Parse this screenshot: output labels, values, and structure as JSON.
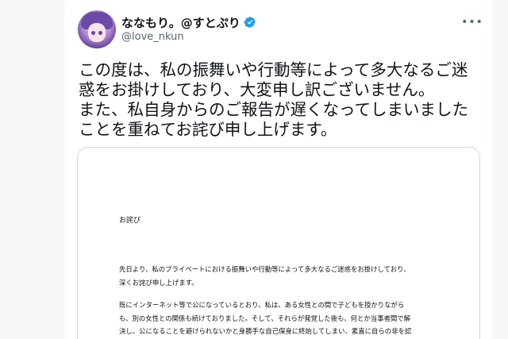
{
  "tweet": {
    "display_name": "ななもり。@すとぷり",
    "handle": "@love_nkun",
    "more_label": "•••",
    "text": "この度は、私の振舞いや行動等によって多大なるご迷惑をお掛けしており、大変申し訳ございません。\nまた、私自身からのご報告が遅くなってしまいましたことを重ねてお詫び申し上げます。",
    "verified_color": "#1d9bf0"
  },
  "attachment": {
    "title": "お詫び",
    "paragraph1": "先日より、私のプライベートにおける振舞いや行動等によって多大なるご迷惑をお掛けしており、\n深くお詫び申し上げます。",
    "paragraph2": "既にインターネット等で公になっているとおり、私は、ある女性との間で子どもを授かりながら\nも、別の女性との関係も続けておりました。そして、それらが発覚した後も、何とか当事者間で解\n決し、公になることを避けられないかと身勝手な自己保身に終始してしまい、素直に自らの非を認\nめてお相手の方々に誠意ある対応をとることができませんでした。"
  },
  "icons": {
    "verified": "verified-badge-icon",
    "more": "more-options-icon",
    "avatar": "profile-avatar"
  }
}
